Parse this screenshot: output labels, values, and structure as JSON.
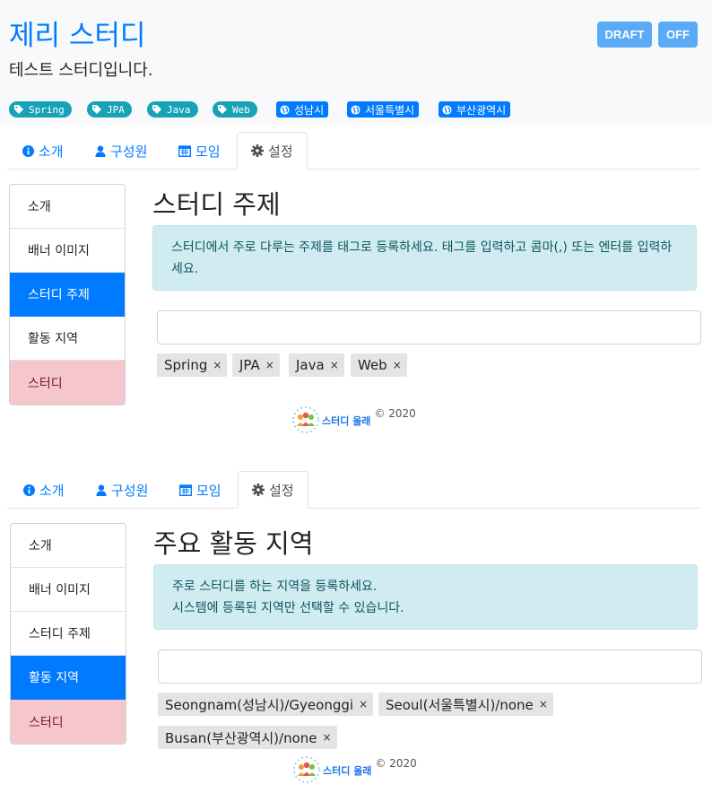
{
  "study": {
    "title": "제리 스터디",
    "description": "테스트 스터디입니다.",
    "badges": {
      "draft": "DRAFT",
      "off": "OFF"
    },
    "tags": [
      "Spring",
      "JPA",
      "Java",
      "Web"
    ],
    "zones": [
      "성남시",
      "서울특별시",
      "부산광역시"
    ]
  },
  "tabs": {
    "intro": "소개",
    "members": "구성원",
    "events": "모임",
    "settings": "설정"
  },
  "side_menu": {
    "intro": "소개",
    "banner": "배너 이미지",
    "tags": "스터디 주제",
    "zones": "활동 지역",
    "study": "스터디"
  },
  "tags_section": {
    "title": "스터디 주제",
    "alert": "스터디에서 주로 다루는 주제를 태그로 등록하세요. 태그를 입력하고 콤마(,) 또는 엔터를 입력하세요.",
    "input_value": "",
    "chips": [
      "Spring",
      "JPA",
      "Java",
      "Web"
    ]
  },
  "zones_section": {
    "title": "주요 활동 지역",
    "alert_line1": "주로 스터디를 하는 지역을 등록하세요.",
    "alert_line2": "시스템에 등록된 지역만 선택할 수 있습니다.",
    "input_value": "",
    "chips": [
      "Seongnam(성남시)/Gyeonggi",
      "Seoul(서울특별시)/none",
      "Busan(부산광역시)/none"
    ]
  },
  "footer": {
    "logo_text": "스터디 올래",
    "copyright": "© 2020"
  },
  "colors": {
    "primary": "#007bff",
    "info_badge": "#17a2b8",
    "alert_bg": "#d1ecf1",
    "danger_bg": "#f5c6cb"
  },
  "icons": {
    "tag": "tag-icon",
    "globe": "globe-icon",
    "info": "info-circle-icon",
    "user": "user-icon",
    "calendar": "calendar-icon",
    "gear": "gear-icon",
    "close": "close-icon"
  }
}
